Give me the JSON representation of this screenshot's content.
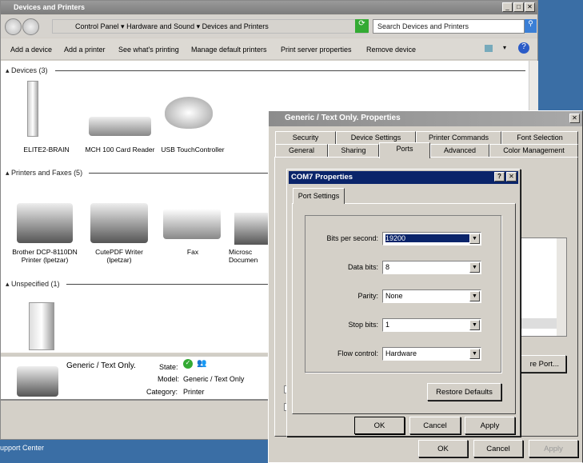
{
  "window": {
    "title": "Devices and Printers",
    "breadcrumb": [
      "Control Panel",
      "Hardware and Sound",
      "Devices and Printers"
    ],
    "search_placeholder": "Search Devices and Printers"
  },
  "toolbar": [
    "Add a device",
    "Add a printer",
    "See what's printing",
    "Manage default printers",
    "Print server properties",
    "Remove device"
  ],
  "sections": {
    "devices": "Devices (3)",
    "printers": "Printers and Faxes (5)",
    "unspecified": "Unspecified (1)"
  },
  "devices": [
    "ELITE2-BRAIN",
    "MCH 100 Card Reader",
    "USB TouchController"
  ],
  "printers": [
    "Brother DCP-8110DN Printer (lpetzar)",
    "CutePDF Writer (lpetzar)",
    "Fax",
    "Microsc Documen"
  ],
  "details": {
    "name": "Generic / Text Only.",
    "state_label": "State:",
    "model_label": "Model:",
    "model": "Generic / Text Only",
    "category_label": "Category:",
    "category": "Printer"
  },
  "taskbar": {
    "text": "upport Center"
  },
  "props": {
    "title": "Generic / Text Only. Properties",
    "tabs_row1": [
      "Security",
      "Device Settings",
      "Printer Commands",
      "Font Selection"
    ],
    "tabs_row2": [
      "General",
      "Sharing",
      "Ports",
      "Advanced",
      "Color Management"
    ],
    "active_tab": "Ports",
    "configure_port": "re Port...",
    "ok": "OK",
    "cancel": "Cancel",
    "apply": "Apply"
  },
  "com7": {
    "title": "COM7 Properties",
    "tab": "Port Settings",
    "fields": [
      {
        "label": "Bits per second:",
        "value": "19200"
      },
      {
        "label": "Data bits:",
        "value": "8"
      },
      {
        "label": "Parity:",
        "value": "None"
      },
      {
        "label": "Stop bits:",
        "value": "1"
      },
      {
        "label": "Flow control:",
        "value": "Hardware"
      }
    ],
    "restore": "Restore Defaults",
    "ok": "OK",
    "cancel": "Cancel",
    "apply": "Apply"
  }
}
